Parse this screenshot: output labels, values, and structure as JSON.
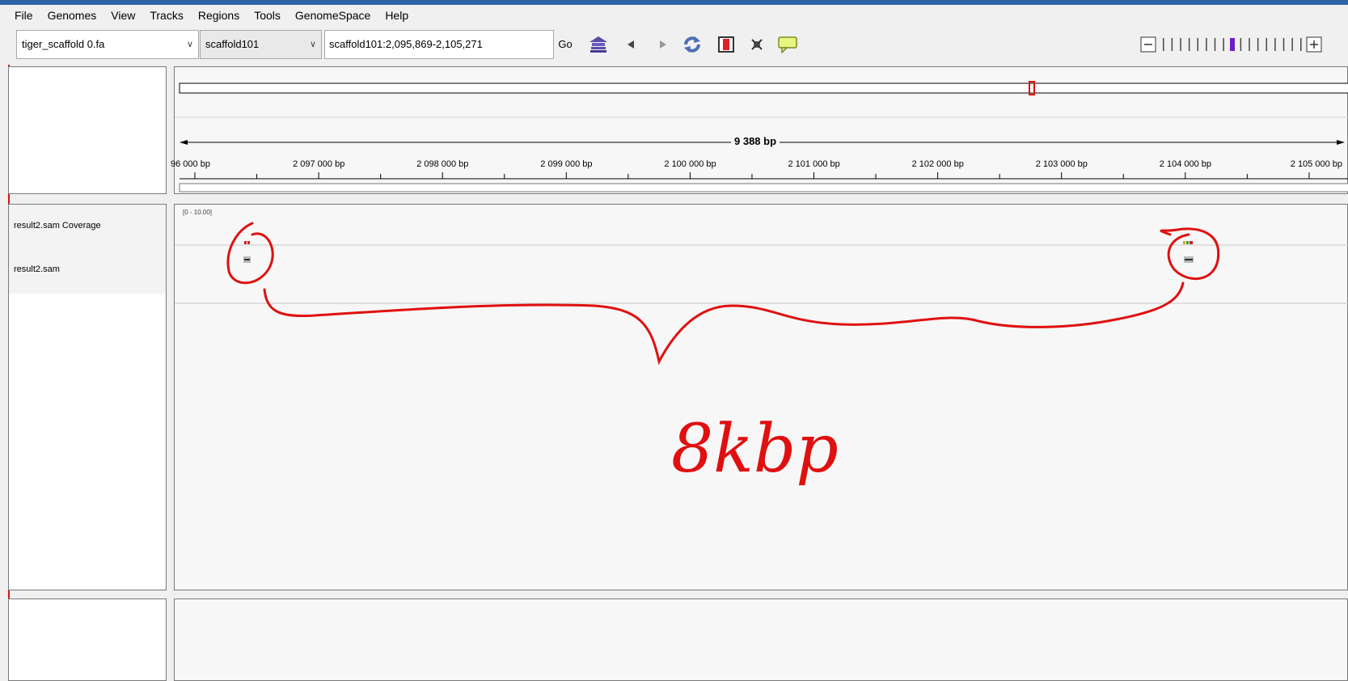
{
  "menu": [
    "File",
    "Genomes",
    "View",
    "Tracks",
    "Regions",
    "Tools",
    "GenomeSpace",
    "Help"
  ],
  "toolbar": {
    "genome": "tiger_scaffold 0.fa",
    "chromosome": "scaffold101",
    "locus": "scaffold101:2,095,869-2,105,271",
    "go_label": "Go",
    "icons": [
      "home-icon",
      "back-icon",
      "forward-icon",
      "refresh-icon",
      "region-of-interest-icon",
      "resize-icon",
      "popup-text-icon"
    ],
    "zoom_level": 8,
    "zoom_ticks": 17
  },
  "ruler": {
    "span_label": "9 388 bp",
    "tick_labels": [
      "96 000 bp",
      "2 097 000 bp",
      "2 098 000 bp",
      "2 099 000 bp",
      "2 100 000 bp",
      "2 101 000 bp",
      "2 102 000 bp",
      "2 103 000 bp",
      "2 104 000 bp",
      "2 105 000 bp"
    ]
  },
  "tracks": {
    "coverage_name": "result2.sam Coverage",
    "alignment_name": "result2.sam",
    "data_range": "[0 - 10.00]"
  },
  "annotation": {
    "text": "8kbp",
    "color": "#e01010"
  },
  "colors": {
    "window_accent": "#2f62a7",
    "zoom_accent": "#6a1ec8",
    "roi_red": "#e01010"
  }
}
